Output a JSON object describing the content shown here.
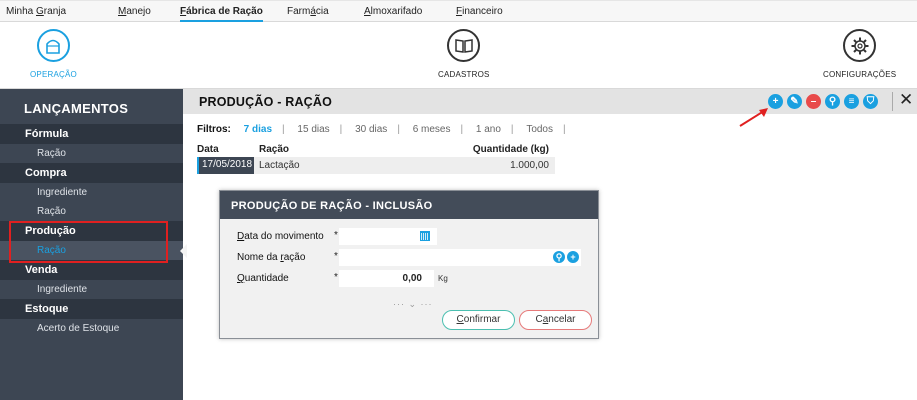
{
  "menu": {
    "tabs": [
      {
        "pre": "Minha ",
        "ul": "G",
        "post": "ranja"
      },
      {
        "pre": "",
        "ul": "M",
        "post": "anejo"
      },
      {
        "pre": "",
        "ul": "F",
        "post": "ábrica de Ração"
      },
      {
        "pre": "Farm",
        "ul": "á",
        "post": "cia"
      },
      {
        "pre": "",
        "ul": "A",
        "post": "lmoxarifado"
      },
      {
        "pre": "",
        "ul": "F",
        "post": "inanceiro"
      }
    ]
  },
  "modules": {
    "operacao": "OPERAÇÃO",
    "cadastros": "CADASTROS",
    "configuracoes": "CONFIGURAÇÕES"
  },
  "sidebar": {
    "title": "LANÇAMENTOS",
    "sections": [
      {
        "label": "Fórmula",
        "items": [
          "Ração"
        ]
      },
      {
        "label": "Compra",
        "items": [
          "Ingrediente",
          "Ração"
        ]
      },
      {
        "label": "Produção",
        "items": [
          "Ração"
        ]
      },
      {
        "label": "Venda",
        "items": [
          "Ingrediente"
        ]
      },
      {
        "label": "Estoque",
        "items": [
          "Acerto de Estoque"
        ]
      }
    ]
  },
  "content": {
    "title": "PRODUÇÃO - RAÇÃO",
    "toolbar": {
      "add": "+",
      "edit": "✎",
      "delete": "–",
      "search": "⚲",
      "report": "≡",
      "filter": "⛉",
      "close": "✕"
    },
    "filters": {
      "label": "Filtros:",
      "options": [
        "7 dias",
        "15 dias",
        "30 dias",
        "6 meses",
        "1 ano",
        "Todos"
      ]
    },
    "table": {
      "headers": {
        "data": "Data",
        "racao": "Ração",
        "quantidade": "Quantidade (kg)"
      },
      "rows": [
        {
          "data": "17/05/2018",
          "racao": "Lactação",
          "quantidade": "1.000,00"
        }
      ]
    }
  },
  "modal": {
    "title": "PRODUÇÃO DE RAÇÃO - INCLUSÃO",
    "fields": {
      "data_movimento": {
        "label_ul": "D",
        "label_rest": "ata do movimento",
        "required": "*",
        "value": ""
      },
      "nome_racao": {
        "label_pre": "Nome da ",
        "label_ul": "r",
        "label_rest": "ação",
        "required": "*",
        "value": ""
      },
      "quantidade": {
        "label_ul": "Q",
        "label_rest": "uantidade",
        "required": "*",
        "value": "0,00",
        "unit": "Kg"
      }
    },
    "more": "··· ⌄ ···",
    "confirm": {
      "ul": "C",
      "rest": "onfirmar"
    },
    "cancel": {
      "pre": "C",
      "ul": "a",
      "rest": "ncelar"
    }
  },
  "colors": {
    "accent": "#1aa0e0",
    "sidebar": "#3d4653",
    "highlight": "#e02020"
  }
}
